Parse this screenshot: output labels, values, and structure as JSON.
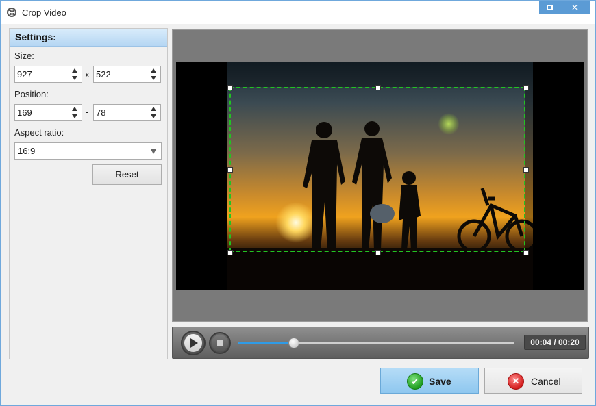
{
  "window": {
    "title": "Crop Video",
    "maximize_icon": "maximize-icon",
    "close_glyph": "✕"
  },
  "settings": {
    "header": "Settings:",
    "size_label": "Size:",
    "size_width": "927",
    "size_sep": "x",
    "size_height": "522",
    "position_label": "Position:",
    "position_x": "169",
    "position_sep": "-",
    "position_y": "78",
    "aspect_label": "Aspect ratio:",
    "aspect_value": "16:9",
    "reset_label": "Reset"
  },
  "player": {
    "time": "00:04 / 00:20",
    "progress": 0.2
  },
  "footer": {
    "save_label": "Save",
    "cancel_label": "Cancel",
    "save_glyph": "✓",
    "cancel_glyph": "✕"
  },
  "colors": {
    "crop_border": "#22c322",
    "accent": "#2f9be6",
    "titlebar_button": "#5b9bd5"
  }
}
